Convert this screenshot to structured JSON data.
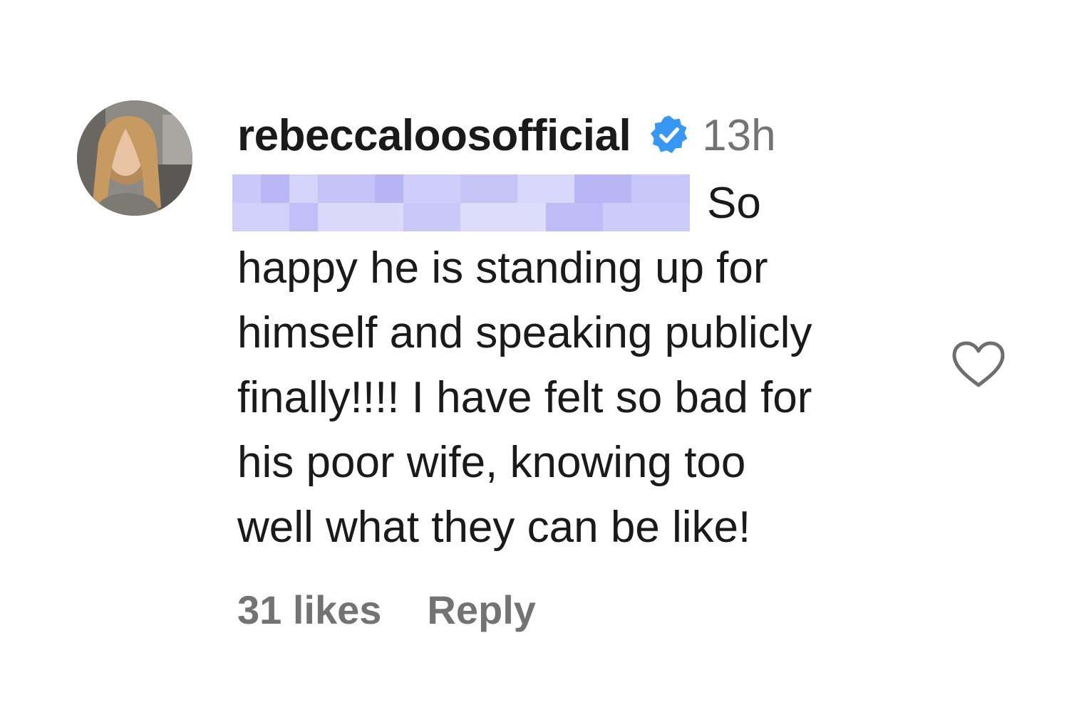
{
  "comment": {
    "username": "rebeccaloosofficial",
    "verified_icon": "verified-badge-icon",
    "timestamp": "13h",
    "body_lines": [
      "So",
      "happy he is standing up for",
      "himself and speaking publicly",
      "finally!!!! I have felt so bad for",
      "his poor wife, knowing too",
      "well what they can be like!"
    ],
    "likes_label": "31 likes",
    "reply_label": "Reply",
    "like_icon": "heart-icon",
    "colors": {
      "text": "#1a1a1a",
      "muted": "#737373",
      "verified": "#3897f0",
      "redaction": "#c4c3f8"
    }
  }
}
